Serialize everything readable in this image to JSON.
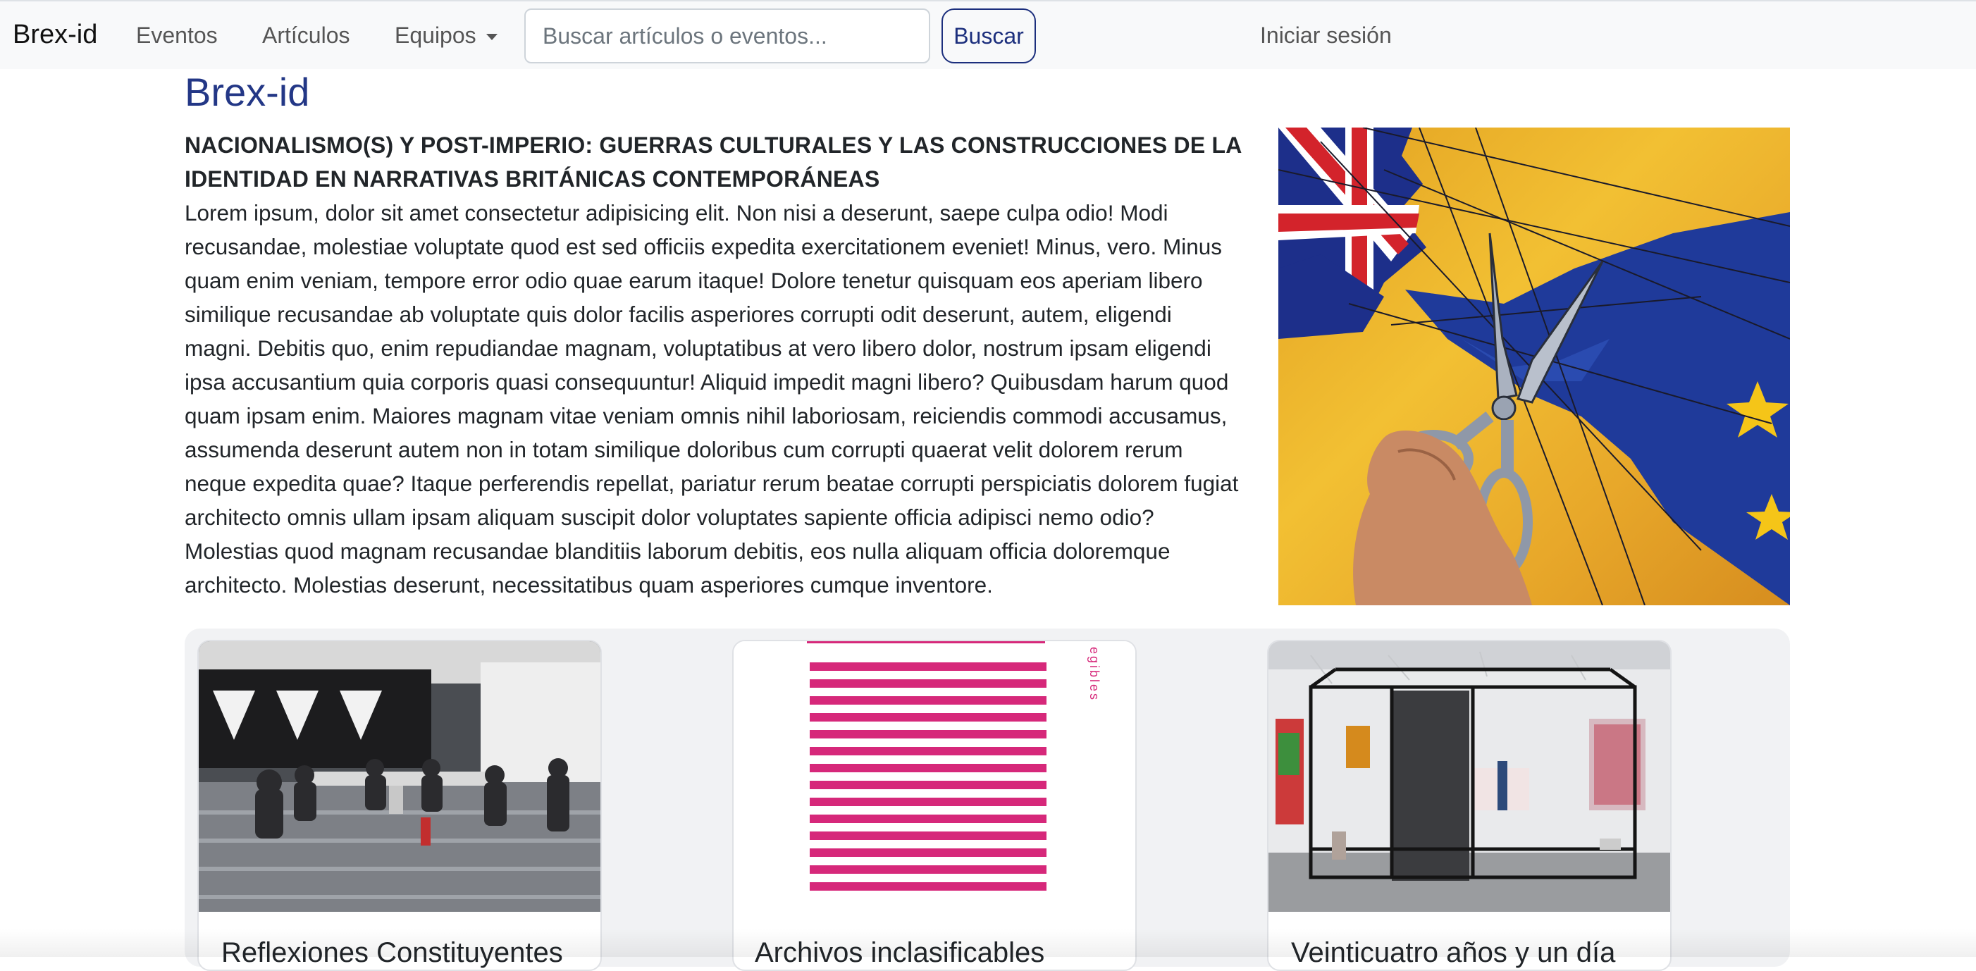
{
  "navbar": {
    "brand": "Brex-id",
    "events_label": "Eventos",
    "articles_label": "Artículos",
    "teams_label": "Equipos",
    "search_placeholder": "Buscar artículos o eventos...",
    "search_value": "",
    "search_button_label": "Buscar",
    "login_label": "Iniciar sesión"
  },
  "hero": {
    "site_title": "Brex-id",
    "article_title": "NACIONALISMO(S) Y POST-IMPERIO: GUERRAS CULTURALES Y LAS CONSTRUCCIONES DE LA IDENTIDAD EN NARRATIVAS BRITÁNICAS CONTEMPORÁNEAS",
    "article_body": "Lorem ipsum, dolor sit amet consectetur adipisicing elit. Non nisi a deserunt, saepe culpa odio! Modi recusandae, molestiae voluptate quod est sed officiis expedita exercitationem eveniet! Minus, vero. Minus quam enim veniam, tempore error odio quae earum itaque! Dolore tenetur quisquam eos aperiam libero similique recusandae ab voluptate quis dolor facilis asperiores corrupti odit deserunt, autem, eligendi magni. Debitis quo, enim repudiandae magnam, voluptatibus at vero libero dolor, nostrum ipsam eligendi ipsa accusantium quia corporis quasi consequuntur! Aliquid impedit magni libero? Quibusdam harum quod quam ipsam enim. Maiores magnam vitae veniam omnis nihil laboriosam, reiciendis commodi accusamus, assumenda deserunt autem non in totam similique doloribus cum corrupti quaerat velit dolorem rerum neque expedita quae? Itaque perferendis repellat, pariatur rerum beatae corrupti perspiciatis dolorem fugiat architecto omnis ullam ipsam aliquam suscipit dolor voluptates sapiente officia adipisci nemo odio? Molestias quod magnam recusandae blanditiis laborum debitis, eos nulla aliquam officia doloremque architecto. Molestias deserunt, necessitatibus quam asperiores cumque inventore.",
    "image_caption": "Scissors cutting between a Union Jack and an EU flag"
  },
  "cards": [
    {
      "title": "Reflexiones Constituyentes"
    },
    {
      "title": "Archivos inclasificables",
      "image_text": "egibles"
    },
    {
      "title": "Veinticuatro años y un día"
    }
  ],
  "colors": {
    "accent": "#233786",
    "button": "#1c2f7d",
    "navbar_bg": "#f8f9fa",
    "stripe_pink": "#d6287a"
  }
}
